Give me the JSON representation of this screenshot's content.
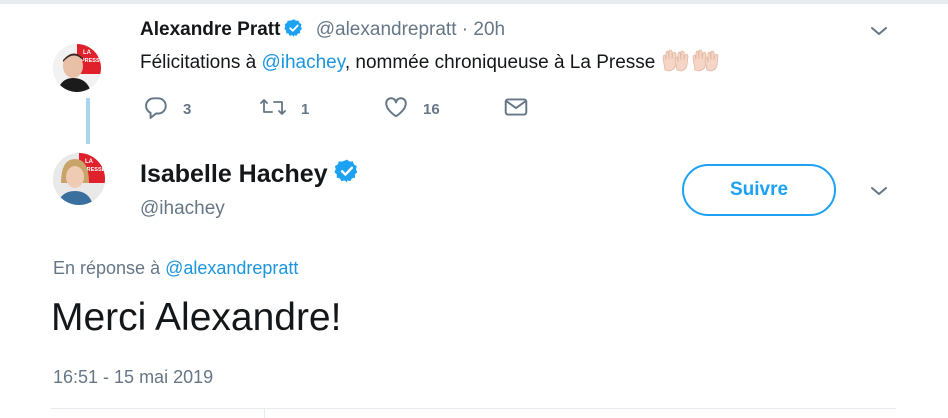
{
  "parent_tweet": {
    "author_name": "Alexandre Pratt",
    "handle": "@alexandrepratt",
    "separator": "·",
    "time": "20h",
    "text_before": "Félicitations à ",
    "mention": "@ihachey",
    "text_after": ", nommée chroniqueuse à La Presse",
    "avatar_badge": "LA PRESSE",
    "actions": {
      "replies": "3",
      "retweets": "1",
      "likes": "16"
    }
  },
  "main_tweet": {
    "author_name": "Isabelle Hachey",
    "handle": "@ihachey",
    "follow_label": "Suivre",
    "reply_prefix": "En réponse à ",
    "reply_mention": "@alexandrepratt",
    "text": "Merci Alexandre!",
    "timestamp": "16:51 - 15 mai 2019",
    "avatar_badge": "LA PRESSE"
  },
  "colors": {
    "accent": "#1da1f2",
    "mention": "#1b95e0",
    "muted": "#657786",
    "verified": "#1da1f2",
    "thread_line": "#a8d6ee"
  },
  "icons": [
    "verified-badge-icon",
    "clapping-hands-emoji",
    "reply-icon",
    "retweet-icon",
    "like-heart-icon",
    "direct-message-icon",
    "chevron-down-icon"
  ]
}
